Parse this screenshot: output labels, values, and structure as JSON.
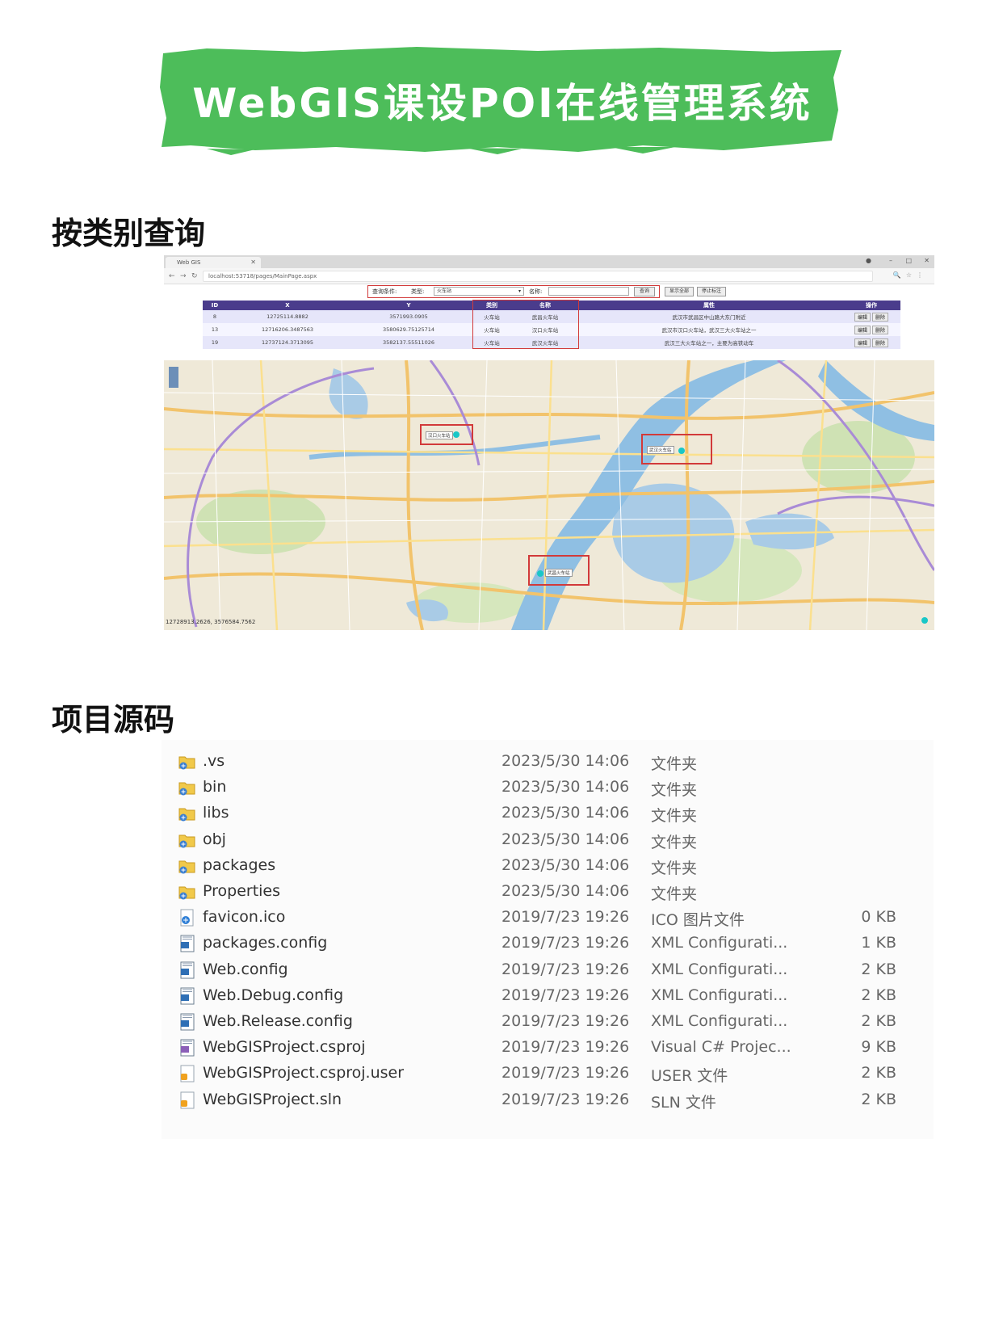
{
  "page": {
    "title": "WebGIS课设POI在线管理系统",
    "section_query": "按类别查询",
    "section_source": "项目源码",
    "banner_color": "#4dbd5a"
  },
  "browser": {
    "tab_title": "Web GIS",
    "url": "localhost:53718/pages/MainPage.aspx",
    "search": {
      "label_condition": "查询条件:",
      "label_type": "类型:",
      "type_value": "火车站",
      "label_name": "名称:",
      "name_value": "",
      "query_button": "查询",
      "show_all_button": "显示全部",
      "stop_label_button": "停止标注"
    },
    "table": {
      "headers": [
        "ID",
        "X",
        "Y",
        "类别",
        "名称",
        "属性",
        "操作"
      ],
      "rows": [
        {
          "id": "8",
          "x": "12725114.8882",
          "y": "3571993.0905",
          "category": "火车站",
          "name": "武昌火车站",
          "attr": "武汉市武昌区中山路大东门附近"
        },
        {
          "id": "13",
          "x": "12716206.3487563",
          "y": "3580629.75125714",
          "category": "火车站",
          "name": "汉口火车站",
          "attr": "武汉市汉口火车站，武汉三大火车站之一"
        },
        {
          "id": "19",
          "x": "12737124.3713095",
          "y": "3582137.55511026",
          "category": "火车站",
          "name": "武汉火车站",
          "attr": "武汉三大火车站之一，主要为高铁动车"
        }
      ],
      "edit_label": "编辑",
      "delete_label": "删除"
    },
    "map": {
      "coord_readout": "12728913.2626, 3576584.7562",
      "markers": [
        "汉口火车站",
        "武汉火车站",
        "武昌火车站"
      ],
      "highlight_color": "#d23a3a",
      "marker_color": "#19c7c7"
    }
  },
  "explorer": {
    "files": [
      {
        "name": ".vs",
        "date": "2023/5/30 14:06",
        "type": "文件夹",
        "size": "",
        "icon": "folder-icon"
      },
      {
        "name": "bin",
        "date": "2023/5/30 14:06",
        "type": "文件夹",
        "size": "",
        "icon": "folder-icon"
      },
      {
        "name": "libs",
        "date": "2023/5/30 14:06",
        "type": "文件夹",
        "size": "",
        "icon": "folder-icon"
      },
      {
        "name": "obj",
        "date": "2023/5/30 14:06",
        "type": "文件夹",
        "size": "",
        "icon": "folder-icon"
      },
      {
        "name": "packages",
        "date": "2023/5/30 14:06",
        "type": "文件夹",
        "size": "",
        "icon": "folder-icon"
      },
      {
        "name": "Properties",
        "date": "2023/5/30 14:06",
        "type": "文件夹",
        "size": "",
        "icon": "folder-icon"
      },
      {
        "name": "favicon.ico",
        "date": "2019/7/23 19:26",
        "type": "ICO 图片文件",
        "size": "0 KB",
        "icon": "image-file-icon"
      },
      {
        "name": "packages.config",
        "date": "2019/7/23 19:26",
        "type": "XML Configurati...",
        "size": "1 KB",
        "icon": "config-file-icon"
      },
      {
        "name": "Web.config",
        "date": "2019/7/23 19:26",
        "type": "XML Configurati...",
        "size": "2 KB",
        "icon": "config-file-icon"
      },
      {
        "name": "Web.Debug.config",
        "date": "2019/7/23 19:26",
        "type": "XML Configurati...",
        "size": "2 KB",
        "icon": "config-file-icon"
      },
      {
        "name": "Web.Release.config",
        "date": "2019/7/23 19:26",
        "type": "XML Configurati...",
        "size": "2 KB",
        "icon": "config-file-icon"
      },
      {
        "name": "WebGISProject.csproj",
        "date": "2019/7/23 19:26",
        "type": "Visual C# Projec...",
        "size": "9 KB",
        "icon": "csproj-file-icon"
      },
      {
        "name": "WebGISProject.csproj.user",
        "date": "2019/7/23 19:26",
        "type": "USER 文件",
        "size": "2 KB",
        "icon": "user-file-icon"
      },
      {
        "name": "WebGISProject.sln",
        "date": "2019/7/23 19:26",
        "type": "SLN 文件",
        "size": "2 KB",
        "icon": "sln-file-icon"
      }
    ]
  }
}
